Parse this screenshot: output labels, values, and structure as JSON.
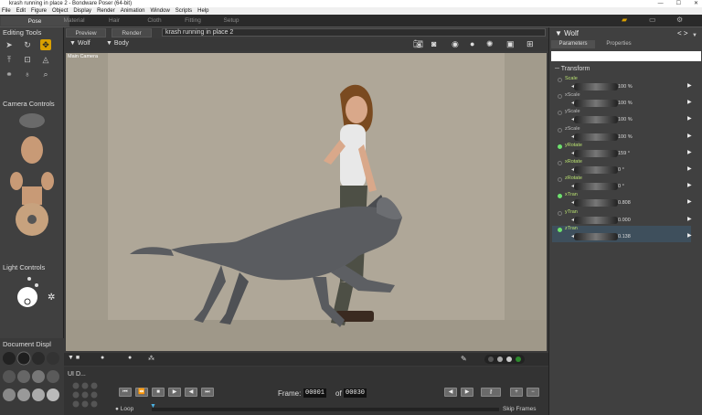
{
  "window": {
    "title": "krash running in place 2 - Bondware Poser (64-bit)"
  },
  "menu": [
    "File",
    "Edit",
    "Figure",
    "Object",
    "Display",
    "Render",
    "Animation",
    "Window",
    "Scripts",
    "Help"
  ],
  "rooms": [
    "Pose",
    "Material",
    "Hair",
    "Cloth",
    "Fitting",
    "Setup"
  ],
  "active_room": "Pose",
  "left": {
    "editing_tools": "Editing Tools",
    "camera_controls": "Camera Controls",
    "light_controls": "Light Controls",
    "document_display": "Document  Displ",
    "ui_dots": "UI D..."
  },
  "viewport": {
    "tabs": [
      "Preview",
      "Render"
    ],
    "document_name": "krash running in place 2",
    "actor_figure": "Wolf",
    "actor_part": "Body",
    "camera_label": "Main Camera"
  },
  "animation": {
    "frame_label": "Frame:",
    "current_frame": "00001",
    "of_label": "of",
    "total_frames": "00030",
    "loop_label": "Loop",
    "skip_frames": "Skip Frames"
  },
  "parameters": {
    "figure": "Wolf",
    "tabs": [
      "Parameters",
      "Properties"
    ],
    "group": "Transform",
    "rows": [
      {
        "name": "Scale",
        "value": "100 %",
        "green": true,
        "dot": false,
        "selected": false
      },
      {
        "name": "xScale",
        "value": "100 %",
        "green": false,
        "dot": false,
        "selected": false
      },
      {
        "name": "yScale",
        "value": "100 %",
        "green": false,
        "dot": false,
        "selected": false
      },
      {
        "name": "zScale",
        "value": "100 %",
        "green": false,
        "dot": false,
        "selected": false
      },
      {
        "name": "yRotate",
        "value": "159 °",
        "green": true,
        "dot": true,
        "selected": false
      },
      {
        "name": "xRotate",
        "value": "0 °",
        "green": true,
        "dot": false,
        "selected": false
      },
      {
        "name": "zRotate",
        "value": "0 °",
        "green": true,
        "dot": false,
        "selected": false
      },
      {
        "name": "xTran",
        "value": "0.808",
        "green": true,
        "dot": true,
        "selected": false
      },
      {
        "name": "yTran",
        "value": "0.000",
        "green": true,
        "dot": false,
        "selected": false
      },
      {
        "name": "zTran",
        "value": "0.138",
        "green": true,
        "dot": true,
        "selected": true
      }
    ]
  },
  "colors": {
    "accent": "#d9a000",
    "selected_row": "#3e4f5c",
    "keyed_dot": "#6ee26e"
  }
}
